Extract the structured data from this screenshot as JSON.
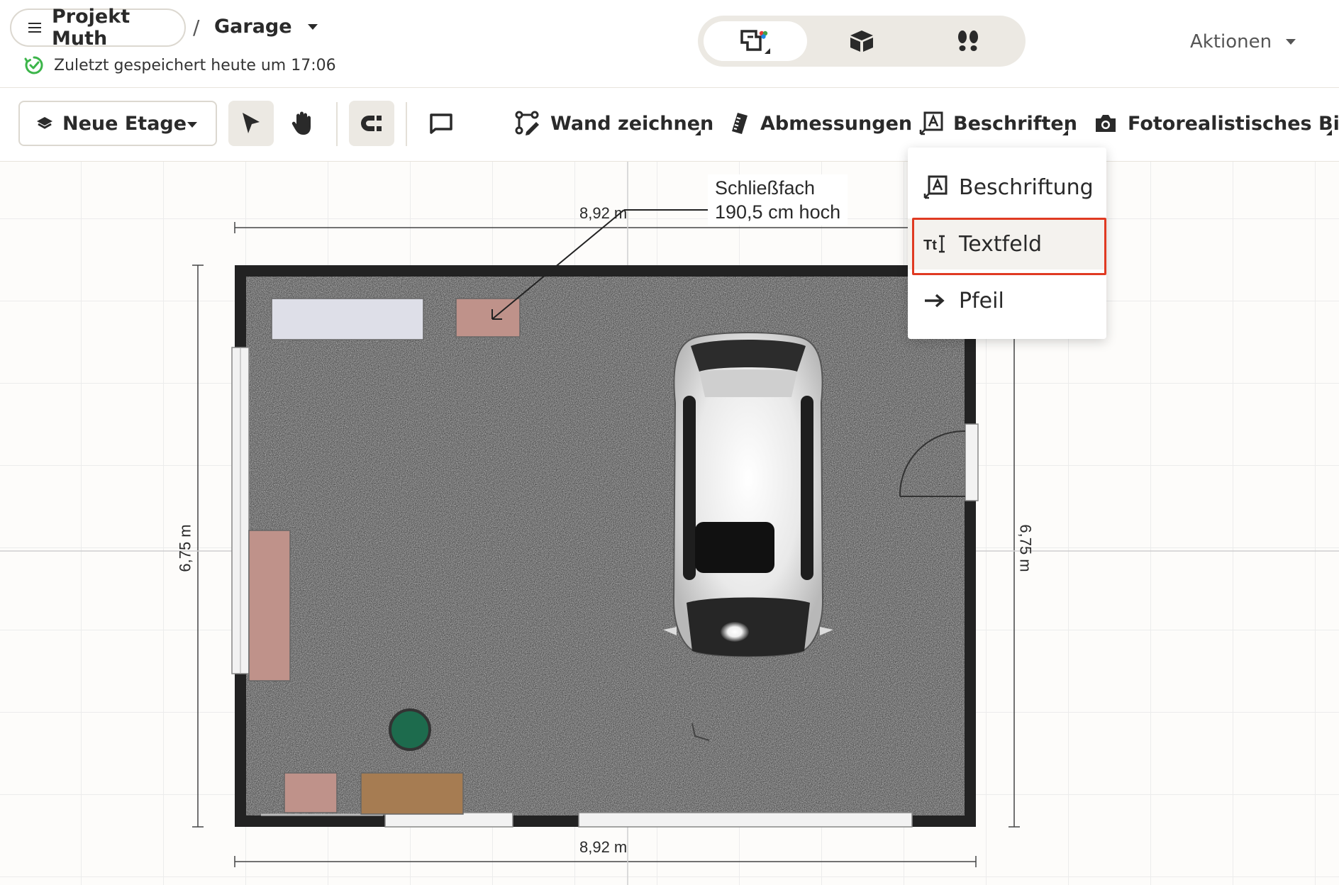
{
  "header": {
    "project_name": "Projekt Muth",
    "separator": "/",
    "floor_name": "Garage",
    "saved_status": "Zuletzt gespeichert heute um 17:06",
    "actions_label": "Aktionen",
    "view_modes": [
      {
        "name": "2d-floorplan-icon",
        "active": true
      },
      {
        "name": "3d-box-icon",
        "active": false
      },
      {
        "name": "walkthrough-footprints-icon",
        "active": false
      }
    ]
  },
  "toolbar": {
    "floor_select_label": "Neue Etage",
    "draw_wall_label": "Wand zeichnen",
    "dimensions_label": "Abmessungen",
    "labels_label": "Beschriften",
    "photo_label": "Fotorealistisches Bild"
  },
  "canvas": {
    "dim_top": "8,92 m",
    "dim_bottom": "8,92 m",
    "dim_left": "6,75 m",
    "dim_right": "6,75 m",
    "callout_line1": "Schließfach",
    "callout_line2": "190,5 cm hoch"
  },
  "menu": {
    "items": [
      {
        "label": "Beschriftung",
        "icon": "label-icon",
        "selected": false
      },
      {
        "label": "Textfeld",
        "icon": "textfield-icon",
        "selected": true
      },
      {
        "label": "Pfeil",
        "icon": "arrow-icon",
        "selected": false
      }
    ]
  },
  "colors": {
    "accent_selection": "#e03a22",
    "saved_ok": "#3cb54a",
    "wall": "#222222",
    "floor_carpet": "#9b9b9b",
    "cabinet": "#bf928a",
    "plant_pot": "#1d6b4d"
  }
}
